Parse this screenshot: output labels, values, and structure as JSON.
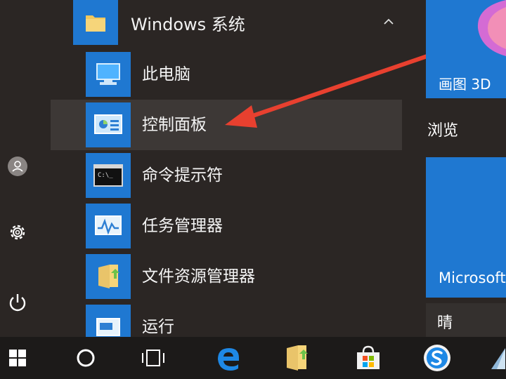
{
  "start_menu": {
    "group": {
      "title": "Windows 系统",
      "expanded": true
    },
    "apps": [
      {
        "label": "此电脑",
        "icon": "computer-icon"
      },
      {
        "label": "控制面板",
        "icon": "control-panel-icon",
        "highlighted": true
      },
      {
        "label": "命令提示符",
        "icon": "command-prompt-icon"
      },
      {
        "label": "任务管理器",
        "icon": "task-manager-icon"
      },
      {
        "label": "文件资源管理器",
        "icon": "file-explorer-icon"
      },
      {
        "label": "运行",
        "icon": "run-icon"
      }
    ],
    "tiles": {
      "paint3d_label": "画图 3D",
      "browse_heading": "浏览",
      "microsoft_label": "Microsoft",
      "weather_label": "晴"
    }
  },
  "rail": {
    "items": [
      "user-icon",
      "settings-icon",
      "power-icon"
    ]
  },
  "taskbar": {
    "items": [
      "windows-start-icon",
      "cortana-icon",
      "task-view-icon",
      "edge-icon",
      "file-explorer-icon",
      "store-icon",
      "sogou-icon",
      "app-icon"
    ]
  },
  "colors": {
    "accent": "#1f78d1",
    "background": "#2b2624",
    "highlight": "#3d3836",
    "taskbar": "#1c1a19",
    "arrow": "#e8402f"
  }
}
